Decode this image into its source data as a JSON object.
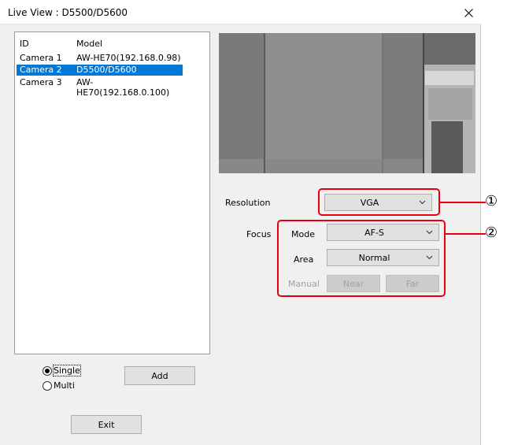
{
  "window": {
    "title": "Live View : D5500/D5600"
  },
  "camera_list": {
    "headers": {
      "id": "ID",
      "model": "Model"
    },
    "rows": [
      {
        "id": "Camera 1",
        "model": "AW-HE70(192.168.0.98)",
        "selected": false
      },
      {
        "id": "Camera 2",
        "model": "D5500/D5600",
        "selected": true
      },
      {
        "id": "Camera 3",
        "model": "AW-HE70(192.168.0.100)",
        "selected": false
      }
    ]
  },
  "settings": {
    "resolution_label": "Resolution",
    "resolution_value": "VGA",
    "focus_label": "Focus",
    "mode_label": "Mode",
    "mode_value": "AF-S",
    "area_label": "Area",
    "area_value": "Normal",
    "manual_label": "Manual",
    "near_label": "Near",
    "far_label": "Far"
  },
  "view_mode": {
    "single_label": "Single",
    "multi_label": "Multi",
    "selected": "Single"
  },
  "buttons": {
    "add": "Add",
    "exit": "Exit"
  },
  "callouts": {
    "one": "①",
    "two": "②"
  },
  "colors": {
    "selection": "#0078d7",
    "callout": "#e60012"
  },
  "icons": [
    "close-icon",
    "chevron-down-icon",
    "radio-icon"
  ]
}
